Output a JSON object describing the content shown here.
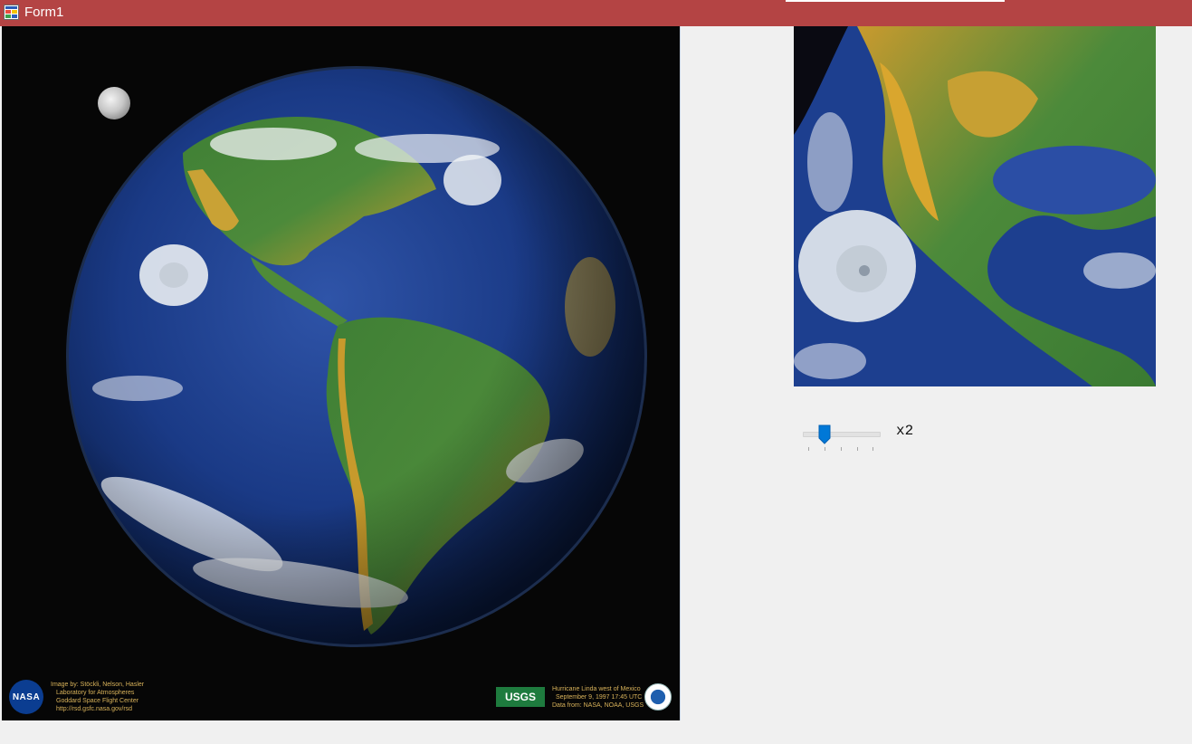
{
  "window": {
    "title": "Form1",
    "titlebar_color": "#b44444",
    "icon": "form-app-icon"
  },
  "main_picture": {
    "description_icon": "earth-image",
    "credits_left": [
      "Image by: Stöckli, Nelson, Hasler",
      "Laboratory for Atmospheres",
      "Goddard Space Flight Center",
      "http://rsd.gsfc.nasa.gov/rsd"
    ],
    "credits_right": [
      "Hurricane Linda west of Mexico",
      "September 9, 1997 17:45 UTC",
      "Data from: NASA, NOAA, USGS"
    ],
    "nasa_label": "NASA",
    "usgs_label": "USGS"
  },
  "zoom_picture": {
    "icon": "zoomed-earth-image"
  },
  "zoom": {
    "label": "x2",
    "min_label": "",
    "max_label": "",
    "value": 2,
    "min": 1,
    "max": 5,
    "accent": "#0078d7"
  }
}
